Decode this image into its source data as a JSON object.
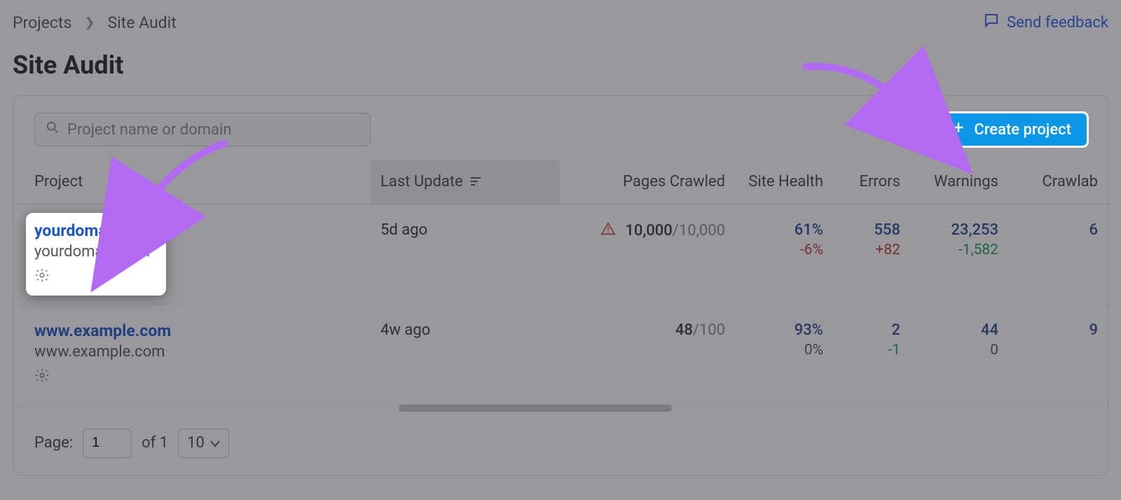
{
  "breadcrumb": {
    "root": "Projects",
    "current": "Site Audit"
  },
  "header": {
    "title": "Site Audit",
    "feedback_label": "Send feedback"
  },
  "search": {
    "placeholder": "Project name or domain"
  },
  "create_button": {
    "label": "Create project"
  },
  "columns": {
    "project": "Project",
    "last_update": "Last Update",
    "pages_crawled": "Pages Crawled",
    "site_health": "Site Health",
    "errors": "Errors",
    "warnings": "Warnings",
    "crawlability": "Crawlab"
  },
  "rows": [
    {
      "name": "yourdomain.com",
      "domain": "yourdomain.com",
      "last_update": "5d ago",
      "crawled_used": "10,000",
      "crawled_total": "/10,000",
      "crawled_alert": true,
      "site_health": "61%",
      "site_health_delta": "-6%",
      "errors": "558",
      "errors_delta": "+82",
      "warnings": "23,253",
      "warnings_delta": "-1,582",
      "crawlability": "6"
    },
    {
      "name": "www.example.com",
      "domain": "www.example.com",
      "last_update": "4w ago",
      "crawled_used": "48",
      "crawled_total": "/100",
      "crawled_alert": false,
      "site_health": "93%",
      "site_health_delta": "0%",
      "errors": "2",
      "errors_delta": "-1",
      "warnings": "44",
      "warnings_delta": "0",
      "crawlability": "9"
    }
  ],
  "pager": {
    "label": "Page:",
    "current": "1",
    "of_label": "of 1",
    "page_size": "10"
  }
}
